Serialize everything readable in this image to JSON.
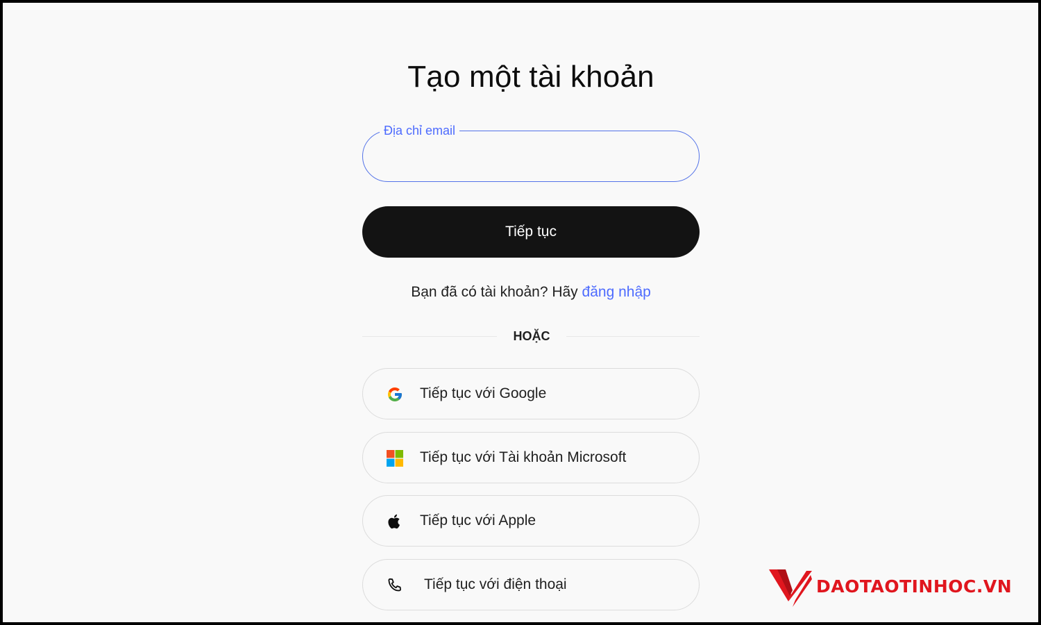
{
  "page": {
    "title": "Tạo một tài khoản"
  },
  "email": {
    "label": "Địa chỉ email",
    "value": ""
  },
  "continue_button": {
    "label": "Tiếp tục"
  },
  "login": {
    "prompt": "Bạn đã có tài khoản? Hãy ",
    "link_text": "đăng nhập"
  },
  "divider": {
    "text": "HOẶC"
  },
  "social": {
    "google": {
      "label": "Tiếp tục với Google",
      "icon": "google-icon"
    },
    "microsoft": {
      "label": "Tiếp tục với Tài khoản Microsoft",
      "icon": "microsoft-icon"
    },
    "apple": {
      "label": "Tiếp tục với Apple",
      "icon": "apple-icon"
    },
    "phone": {
      "label": "Tiếp tục với điện thoại",
      "icon": "phone-icon"
    }
  },
  "watermark": {
    "text": "DAOTAOTINHOC.VN",
    "color": "#e0161e"
  },
  "colors": {
    "accent": "#4d6bfe",
    "primary_button": "#131313",
    "background": "#f9f9f9"
  }
}
